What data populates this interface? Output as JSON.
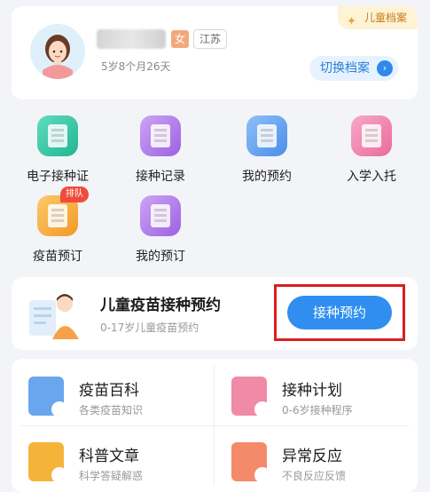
{
  "profile": {
    "archive_tag": "儿童档案",
    "gender": "女",
    "region": "江苏",
    "age": "5岁8个月26天",
    "switch_label": "切换档案"
  },
  "grid": [
    {
      "label": "电子接种证",
      "icon": "vaccine-certificate-icon",
      "color": "#2fc7a3"
    },
    {
      "label": "接种记录",
      "icon": "vaccination-record-icon",
      "color": "#b07ae8"
    },
    {
      "label": "我的预约",
      "icon": "my-appointment-icon",
      "color": "#5a9cf0"
    },
    {
      "label": "入学入托",
      "icon": "school-entry-icon",
      "color": "#f07aa8"
    },
    {
      "label": "疫苗预订",
      "icon": "vaccine-booking-icon",
      "color": "#f5a83a",
      "badge": "排队"
    },
    {
      "label": "我的预订",
      "icon": "my-booking-icon",
      "color": "#b07ae8"
    }
  ],
  "appointment": {
    "title": "儿童疫苗接种预约",
    "subtitle": "0-17岁儿童疫苗预约",
    "button": "接种预约"
  },
  "services": [
    {
      "title": "疫苗百科",
      "subtitle": "各类疫苗知识",
      "icon": "vaccine-encyclopedia-icon",
      "color": "#6aa6ee"
    },
    {
      "title": "接种计划",
      "subtitle": "0-6岁接种程序",
      "icon": "vaccination-plan-icon",
      "color": "#f08aa6"
    },
    {
      "title": "科普文章",
      "subtitle": "科学答疑解惑",
      "icon": "science-article-icon",
      "color": "#f5b33a"
    },
    {
      "title": "异常反应",
      "subtitle": "不良反应反馈",
      "icon": "adverse-reaction-icon",
      "color": "#f58a6a"
    }
  ]
}
